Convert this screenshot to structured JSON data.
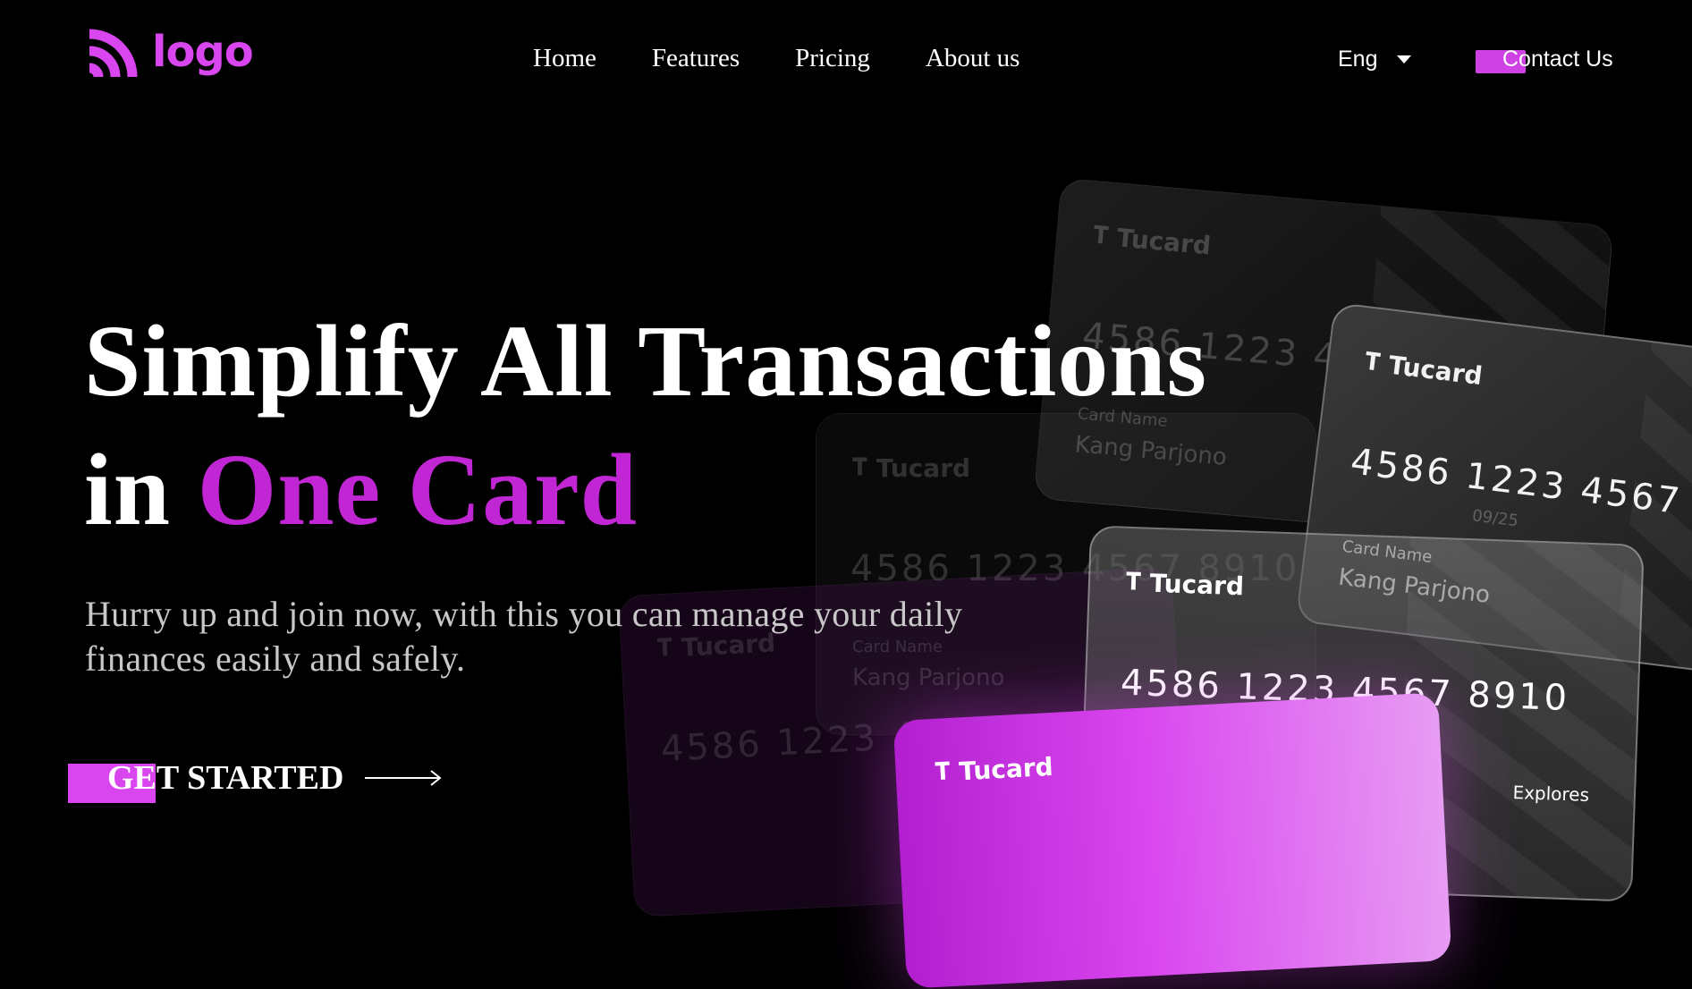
{
  "header": {
    "logo_text": "logo",
    "nav": [
      "Home",
      "Features",
      "Pricing",
      "About us"
    ],
    "language": "Eng",
    "contact_label": "Contact Us"
  },
  "hero": {
    "title_line1": "Simplify All Transactions",
    "title_line2_prefix": "in ",
    "title_line2_accent": "One Card",
    "subtitle": "Hurry up and join now, with this you can manage your daily finances easily and safely.",
    "cta_label": "GET STARTED"
  },
  "card": {
    "brand": "Tucard",
    "number": "4586 1223 4567 8910",
    "expiry": "09/25",
    "name_label": "Card Name",
    "holder": "Kang Parjono",
    "extra": "Explores"
  },
  "colors": {
    "accent": "#d946ef",
    "accent_dark": "#c026d3",
    "background": "#000000"
  }
}
